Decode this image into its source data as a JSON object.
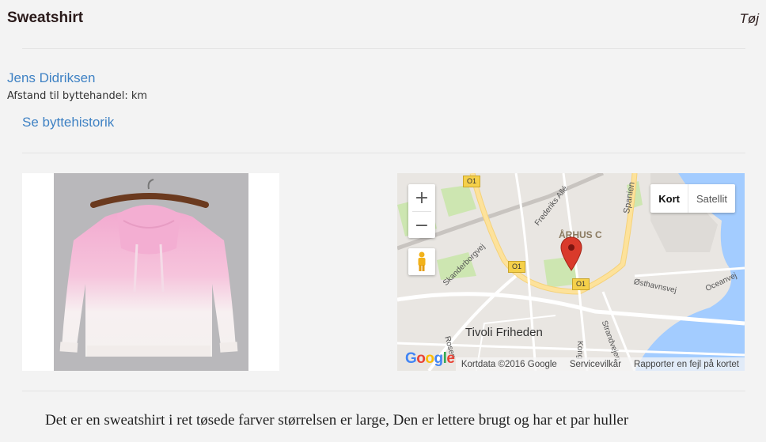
{
  "header": {
    "title": "Sweatshirt",
    "category": "Tøj"
  },
  "owner": {
    "name": "Jens Didriksen",
    "distance_label": "Afstand til byttehandel: km",
    "history_link": "Se byttehistorik"
  },
  "map": {
    "zoom_in": "+",
    "zoom_out": "−",
    "type_map": "Kort",
    "type_satellite": "Satellit",
    "labels": {
      "city": "ÅRHUS C",
      "park": "Tivoli Friheden",
      "road_skanderborgvej": "Skanderborgvej",
      "road_frederiks": "Frederiks Allé",
      "road_spanien": "Spanien",
      "road_osthavnsvej": "Østhavnsvej",
      "road_oceanvej": "Oceanvej",
      "road_strandvejen": "Strandvejen",
      "road_rosen": "Rosen",
      "road_kong": "Kong",
      "route": "O1"
    },
    "attribution": "Kortdata ©2016 Google",
    "terms": "Servicevilkår",
    "report": "Rapporter en fejl på kortet",
    "logo": "Google"
  },
  "description": "Det er en sweatshirt i ret tøsede farver størrelsen er large, Den er lettere brugt og har et par huller",
  "colors": {
    "link": "#3f82c4",
    "background": "#f3f3f3",
    "marker": "#d93a2b",
    "water": "#a3ccff",
    "park": "#cde6b1",
    "highway": "#fde29b"
  }
}
